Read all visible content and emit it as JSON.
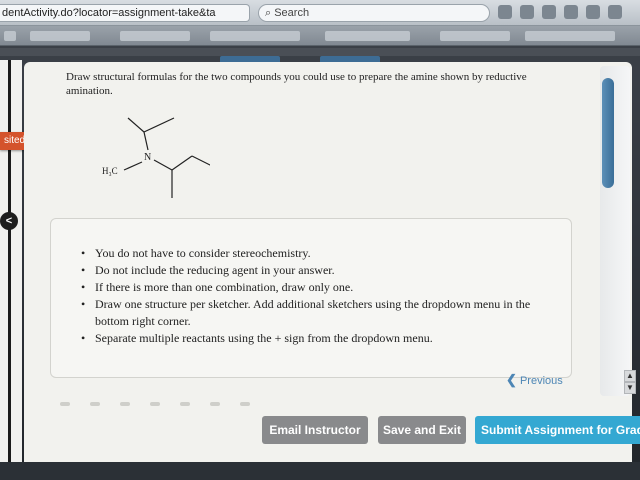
{
  "browser": {
    "url": "dentActivity.do?locator=assignment-take&ta",
    "url_controls": "▼ C",
    "search_placeholder": "Search"
  },
  "sidebar": {
    "status_label": "sited",
    "collapse_label": "<"
  },
  "question": {
    "prompt": "Draw structural formulas for the two compounds you could use to prepare the amine shown by reductive amination.",
    "molecule_labels": {
      "nitrogen": "N",
      "methyl": "H₃C"
    }
  },
  "instructions": {
    "items": [
      "You do not have to consider stereochemistry.",
      "Do not include the reducing agent in your answer.",
      "If there is more than one combination, draw only one.",
      "Draw one structure per sketcher. Add additional sketchers using the dropdown menu in the bottom right corner.",
      "Separate multiple reactants using the + sign from the dropdown menu."
    ]
  },
  "navigation": {
    "previous_label": "Previous",
    "previous_icon": "chevron-left-icon"
  },
  "footer_buttons": {
    "email": "Email Instructor",
    "save": "Save and Exit",
    "submit": "Submit Assignment for Grading"
  },
  "colors": {
    "submit_button": "#34a8d2",
    "secondary_button": "#898a8c",
    "status_tab": "#d4532c",
    "link": "#4d86b5"
  }
}
